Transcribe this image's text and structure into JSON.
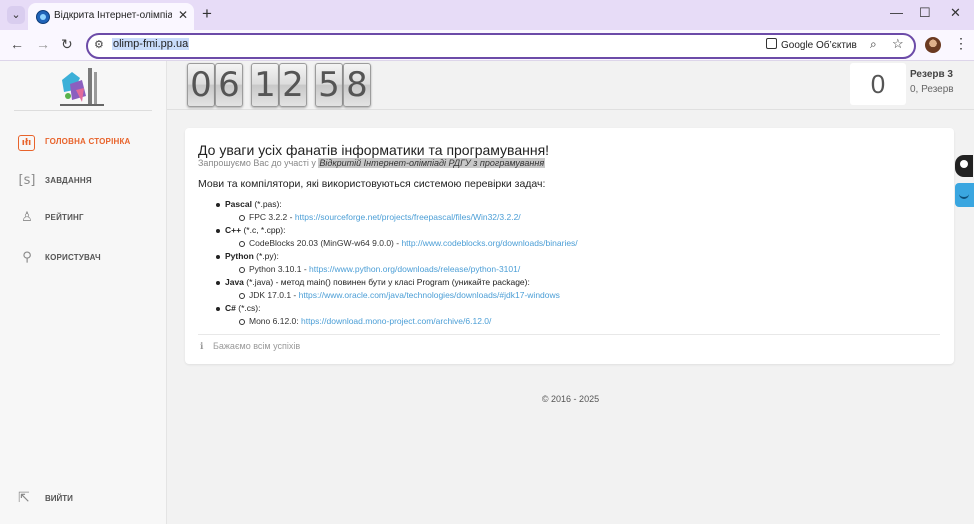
{
  "browser": {
    "tab_title": "Відкрита Інтернет-олімпіада РДГУ",
    "url": "olimp-fmi.pp.ua",
    "lens_label": "Google Об’єктив"
  },
  "sidebar": {
    "items": [
      {
        "label": "ГОЛОВНА СТОРІНКА",
        "icon": "home-code-icon"
      },
      {
        "label": "ЗАВДАННЯ",
        "icon": "tasks-icon",
        "glyph": "[s]"
      },
      {
        "label": "РЕЙТИНГ",
        "icon": "trophy-icon"
      },
      {
        "label": "КОРИСТУВАЧ",
        "icon": "user-icon"
      }
    ],
    "logout_label": "ВИЙТИ"
  },
  "timer": {
    "digits": [
      "0",
      "6",
      "1",
      "2",
      "5",
      "8"
    ]
  },
  "user": {
    "score": "0",
    "name": "Резерв 3",
    "sub": "0, Резерв"
  },
  "card": {
    "title": "До уваги усіх фанатів інформатики та програмування!",
    "sub_prefix": "Запрошуємо Вас до участі у ",
    "sub_highlight": "Відкритій Інтернет-олімпіаді РДГУ з програмування",
    "lead": "Мови та компілятори, які використовуються системою перевірки задач:",
    "languages": [
      {
        "name": "Pascal",
        "ext": " (*.pas):",
        "items": [
          {
            "text": "FPC 3.2.2 - ",
            "link": "https://sourceforge.net/projects/freepascal/files/Win32/3.2.2/"
          }
        ]
      },
      {
        "name": "C++",
        "ext": " (*.c, *.cpp):",
        "items": [
          {
            "text": "CodeBlocks 20.03 (MinGW-w64 9.0.0) - ",
            "link": "http://www.codeblocks.org/downloads/binaries/"
          }
        ]
      },
      {
        "name": "Python",
        "ext": " (*.py):",
        "items": [
          {
            "text": "Python 3.10.1 - ",
            "link": "https://www.python.org/downloads/release/python-3101/"
          }
        ]
      },
      {
        "name": "Java",
        "ext": " (*.java) - метод main() повинен бути у класі Program (уникайте package):",
        "items": [
          {
            "text": "JDK 17.0.1 - ",
            "link": "https://www.oracle.com/java/technologies/downloads/#jdk17-windows"
          }
        ]
      },
      {
        "name": "C#",
        "ext": " (*.cs):",
        "items": [
          {
            "text": "Mono 6.12.0: ",
            "link": "https://download.mono-project.com/archive/6.12.0/"
          }
        ]
      }
    ],
    "footer": "Бажаємо всім успіхів"
  },
  "copyright": "© 2016 - 2025"
}
